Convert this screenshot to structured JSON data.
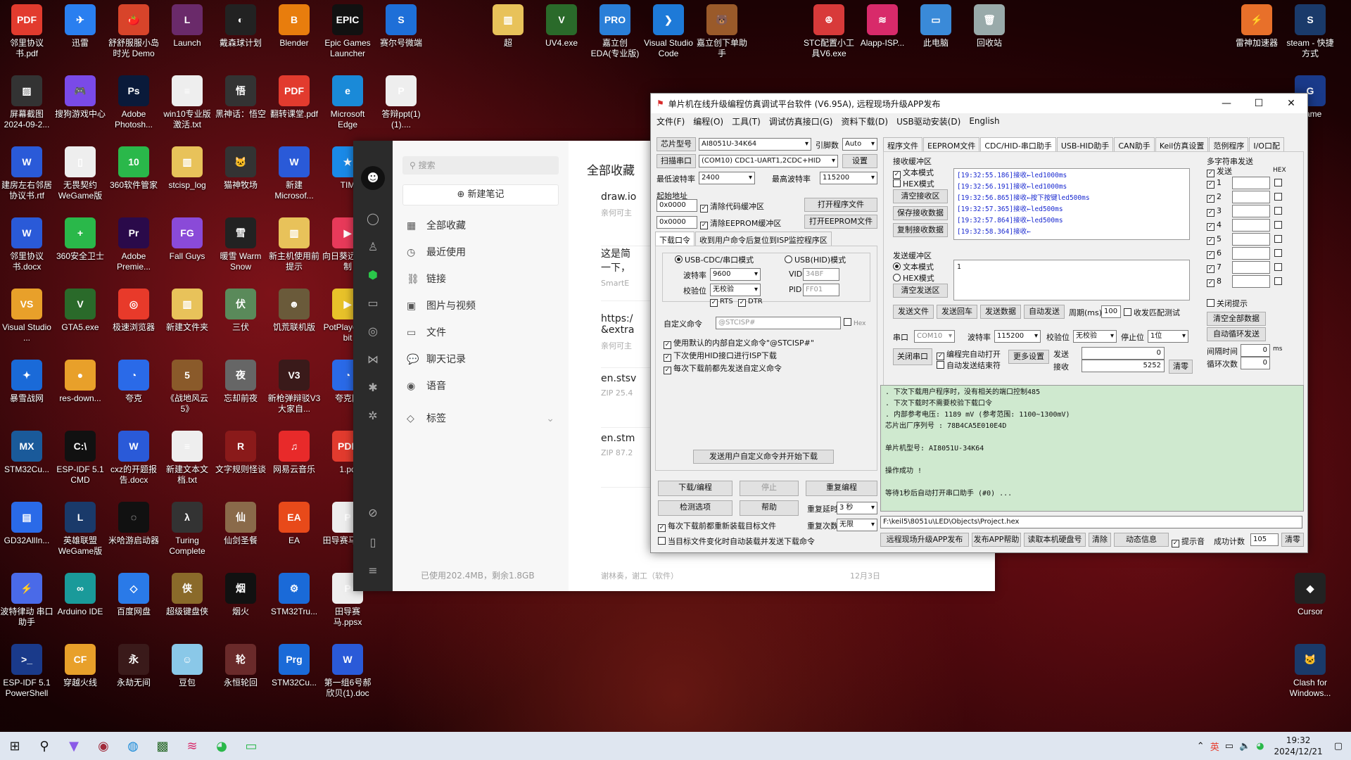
{
  "desktop": {
    "icons": [
      {
        "label": "邻里协议书.pdf",
        "col": 0,
        "row": 0,
        "color": "#e23b2e",
        "glyph": "PDF"
      },
      {
        "label": "迅雷",
        "col": 1,
        "row": 0,
        "color": "#2a7ff0",
        "glyph": "✈"
      },
      {
        "label": "舒舒服服小岛时光 Demo",
        "col": 2,
        "row": 0,
        "color": "#d8442a",
        "glyph": "🍅"
      },
      {
        "label": "Launch",
        "col": 3,
        "row": 0,
        "color": "#6a2a6a",
        "glyph": "L"
      },
      {
        "label": "戴森球计划",
        "col": 4,
        "row": 0,
        "color": "#222",
        "glyph": "◐"
      },
      {
        "label": "Blender",
        "col": 5,
        "row": 0,
        "color": "#e87d0d",
        "glyph": "B"
      },
      {
        "label": "Epic Games Launcher",
        "col": 6,
        "row": 0,
        "color": "#111",
        "glyph": "EPIC"
      },
      {
        "label": "赛尔号微端",
        "col": 7,
        "row": 0,
        "color": "#1e6fd8",
        "glyph": "S"
      },
      {
        "label": "超",
        "col": 9,
        "row": 0,
        "color": "#e8c25a",
        "glyph": "▥"
      },
      {
        "label": "UV4.exe",
        "col": 10,
        "row": 0,
        "color": "#2a6a2a",
        "glyph": "V"
      },
      {
        "label": "嘉立创EDA(专业版)",
        "col": 11,
        "row": 0,
        "color": "#2a7fd8",
        "glyph": "PRO"
      },
      {
        "label": "Visual Studio Code",
        "col": 12,
        "row": 0,
        "color": "#1e7ad8",
        "glyph": "❯"
      },
      {
        "label": "嘉立创下单助手",
        "col": 13,
        "row": 0,
        "color": "#9a5a2a",
        "glyph": "🐻"
      },
      {
        "label": "STC配置小工具V6.exe",
        "col": 15,
        "row": 0,
        "color": "#d83a3a",
        "glyph": "ꔮ"
      },
      {
        "label": "Alapp-ISP...",
        "col": 16,
        "row": 0,
        "color": "#d82a6a",
        "glyph": "≋"
      },
      {
        "label": "此电脑",
        "col": 17,
        "row": 0,
        "color": "#3a8ad8",
        "glyph": "▭"
      },
      {
        "label": "回收站",
        "col": 18,
        "row": 0,
        "color": "#9aa",
        "glyph": "🗑"
      },
      {
        "label": "雷神加速器",
        "col": 23,
        "row": 0,
        "color": "#e8702a",
        "glyph": "⚡"
      },
      {
        "label": "steam - 快捷方式",
        "col": 24,
        "row": 0,
        "color": "#1a3a6a",
        "glyph": "S"
      },
      {
        "label": "屏幕截图 2024-09-2...",
        "col": 0,
        "row": 1,
        "color": "#333",
        "glyph": "▨"
      },
      {
        "label": "搜狗游戏中心",
        "col": 1,
        "row": 1,
        "color": "#7a4ae8",
        "glyph": "🎮"
      },
      {
        "label": "Adobe Photosh...",
        "col": 2,
        "row": 1,
        "color": "#0a1a3a",
        "glyph": "Ps"
      },
      {
        "label": "win10专业版激活.txt",
        "col": 3,
        "row": 1,
        "color": "#eee",
        "glyph": "≡"
      },
      {
        "label": "黑神话：悟空",
        "col": 4,
        "row": 1,
        "color": "#333",
        "glyph": "悟"
      },
      {
        "label": "翻转课堂.pdf",
        "col": 5,
        "row": 1,
        "color": "#e23b2e",
        "glyph": "PDF"
      },
      {
        "label": "Microsoft Edge",
        "col": 6,
        "row": 1,
        "color": "#1a8ad8",
        "glyph": "e"
      },
      {
        "label": "答辩ppt(1)(1)....",
        "col": 7,
        "row": 1,
        "color": "#eee",
        "glyph": "P"
      },
      {
        "label": "Game",
        "col": 24,
        "row": 1,
        "color": "#1a3a8a",
        "glyph": "G"
      },
      {
        "label": "建房左右邻居协议书.rtf",
        "col": 0,
        "row": 2,
        "color": "#2a5ad8",
        "glyph": "W"
      },
      {
        "label": "无畏契约 WeGame版",
        "col": 1,
        "row": 2,
        "color": "#eee",
        "glyph": "▯"
      },
      {
        "label": "360软件管家",
        "col": 2,
        "row": 2,
        "color": "#2ab84a",
        "glyph": "10"
      },
      {
        "label": "stcisp_log",
        "col": 3,
        "row": 2,
        "color": "#e8c25a",
        "glyph": "▥"
      },
      {
        "label": "猫神牧场",
        "col": 4,
        "row": 2,
        "color": "#333",
        "glyph": "🐱"
      },
      {
        "label": "新建 Microsof...",
        "col": 5,
        "row": 2,
        "color": "#2a5ad8",
        "glyph": "W"
      },
      {
        "label": "TIM",
        "col": 6,
        "row": 2,
        "color": "#1a8ae8",
        "glyph": "★"
      },
      {
        "label": "邻里协议书.docx",
        "col": 0,
        "row": 3,
        "color": "#2a5ad8",
        "glyph": "W"
      },
      {
        "label": "360安全卫士",
        "col": 1,
        "row": 3,
        "color": "#2ab84a",
        "glyph": "+"
      },
      {
        "label": "Adobe Premie...",
        "col": 2,
        "row": 3,
        "color": "#2a0a4a",
        "glyph": "Pr"
      },
      {
        "label": "Fall Guys",
        "col": 3,
        "row": 3,
        "color": "#8a4ad8",
        "glyph": "FG"
      },
      {
        "label": "暖雪 Warm Snow",
        "col": 4,
        "row": 3,
        "color": "#222",
        "glyph": "雪"
      },
      {
        "label": "新主机使用前提示",
        "col": 5,
        "row": 3,
        "color": "#e8c25a",
        "glyph": "▥"
      },
      {
        "label": "向日葵远程控制",
        "col": 6,
        "row": 3,
        "color": "#e83a5a",
        "glyph": "▶"
      },
      {
        "label": "Visual Studio ...",
        "col": 0,
        "row": 4,
        "color": "#e8a02a",
        "glyph": "VS"
      },
      {
        "label": "GTA5.exe",
        "col": 1,
        "row": 4,
        "color": "#2a6a2a",
        "glyph": "V"
      },
      {
        "label": "极速浏览器",
        "col": 2,
        "row": 4,
        "color": "#e83a2a",
        "glyph": "◎"
      },
      {
        "label": "新建文件夹",
        "col": 3,
        "row": 4,
        "color": "#e8c25a",
        "glyph": "▥"
      },
      {
        "label": "三伏",
        "col": 4,
        "row": 4,
        "color": "#5a8a5a",
        "glyph": "伏"
      },
      {
        "label": "饥荒联机版",
        "col": 5,
        "row": 4,
        "color": "#6a5a3a",
        "glyph": "☻"
      },
      {
        "label": "PotPlayer 64 bit",
        "col": 6,
        "row": 4,
        "color": "#e8c22a",
        "glyph": "▶"
      },
      {
        "label": "暴雪战网",
        "col": 0,
        "row": 5,
        "color": "#1a6ad8",
        "glyph": "✦"
      },
      {
        "label": "res-down...",
        "col": 1,
        "row": 5,
        "color": "#e8a02a",
        "glyph": "●"
      },
      {
        "label": "夸克",
        "col": 2,
        "row": 5,
        "color": "#2a6ae8",
        "glyph": "◔"
      },
      {
        "label": "《战地风云 5》",
        "col": 3,
        "row": 5,
        "color": "#8a5a2a",
        "glyph": "5"
      },
      {
        "label": "忘却前夜",
        "col": 4,
        "row": 5,
        "color": "#666",
        "glyph": "夜"
      },
      {
        "label": "新枪弹辩驳V3 大家自...",
        "col": 5,
        "row": 5,
        "color": "#3a1a1a",
        "glyph": "V3"
      },
      {
        "label": "夸克网",
        "col": 6,
        "row": 5,
        "color": "#2a6ae8",
        "glyph": "◔"
      },
      {
        "label": "STM32Cu...",
        "col": 0,
        "row": 6,
        "color": "#1a5a9a",
        "glyph": "MX"
      },
      {
        "label": "ESP-IDF 5.1 CMD",
        "col": 1,
        "row": 6,
        "color": "#111",
        "glyph": "C:\\"
      },
      {
        "label": "cxz的开题报告.docx",
        "col": 2,
        "row": 6,
        "color": "#2a5ad8",
        "glyph": "W"
      },
      {
        "label": "新建文本文档.txt",
        "col": 3,
        "row": 6,
        "color": "#eee",
        "glyph": "≡"
      },
      {
        "label": "文字规则怪谈",
        "col": 4,
        "row": 6,
        "color": "#8a1a1a",
        "glyph": "R"
      },
      {
        "label": "网易云音乐",
        "col": 5,
        "row": 6,
        "color": "#e82a2a",
        "glyph": "♫"
      },
      {
        "label": "1.pd",
        "col": 6,
        "row": 6,
        "color": "#e23b2e",
        "glyph": "PDF"
      },
      {
        "label": "GD32AllIn...",
        "col": 0,
        "row": 7,
        "color": "#2a6ae8",
        "glyph": "▤"
      },
      {
        "label": "英雄联盟 WeGame版",
        "col": 1,
        "row": 7,
        "color": "#1a3a6a",
        "glyph": "L"
      },
      {
        "label": "米哈游启动器",
        "col": 2,
        "row": 7,
        "color": "#111",
        "glyph": "◌"
      },
      {
        "label": "Turing Complete",
        "col": 3,
        "row": 7,
        "color": "#333",
        "glyph": "λ"
      },
      {
        "label": "仙剑圣餐",
        "col": 4,
        "row": 7,
        "color": "#8a6a4a",
        "glyph": "仙"
      },
      {
        "label": "EA",
        "col": 5,
        "row": 7,
        "color": "#e84a1a",
        "glyph": "EA"
      },
      {
        "label": "田导赛马pptx",
        "col": 6,
        "row": 7,
        "color": "#eee",
        "glyph": "P"
      },
      {
        "label": "波特律动 串口助手",
        "col": 0,
        "row": 8,
        "color": "#4a6ae8",
        "glyph": "⚡"
      },
      {
        "label": "Arduino IDE",
        "col": 1,
        "row": 8,
        "color": "#1a9a9a",
        "glyph": "∞"
      },
      {
        "label": "百度网盘",
        "col": 2,
        "row": 8,
        "color": "#2a7ae8",
        "glyph": "◇"
      },
      {
        "label": "超级键盘侠",
        "col": 3,
        "row": 8,
        "color": "#8a6a2a",
        "glyph": "侠"
      },
      {
        "label": "烟火",
        "col": 4,
        "row": 8,
        "color": "#111",
        "glyph": "烟"
      },
      {
        "label": "STM32Tru...",
        "col": 5,
        "row": 8,
        "color": "#1a6ad8",
        "glyph": "⚙"
      },
      {
        "label": "田导赛马.ppsx",
        "col": 6,
        "row": 8,
        "color": "#eee",
        "glyph": "P"
      },
      {
        "label": "Cursor",
        "col": 24,
        "row": 8,
        "color": "#222",
        "glyph": "◆"
      },
      {
        "label": "ESP-IDF 5.1 PowerShell",
        "col": 0,
        "row": 9,
        "color": "#1a3a8a",
        "glyph": ">_"
      },
      {
        "label": "穿越火线",
        "col": 1,
        "row": 9,
        "color": "#e8a02a",
        "glyph": "CF"
      },
      {
        "label": "永劫无间",
        "col": 2,
        "row": 9,
        "color": "#3a1a1a",
        "glyph": "永"
      },
      {
        "label": "豆包",
        "col": 3,
        "row": 9,
        "color": "#8ac8e8",
        "glyph": "☺"
      },
      {
        "label": "永恒轮回",
        "col": 4,
        "row": 9,
        "color": "#6a2a2a",
        "glyph": "轮"
      },
      {
        "label": "STM32Cu...",
        "col": 5,
        "row": 9,
        "color": "#1a6ad8",
        "glyph": "Prg"
      },
      {
        "label": "第一组6号郝欣贝(1).doc",
        "col": 6,
        "row": 9,
        "color": "#2a5ad8",
        "glyph": "W"
      },
      {
        "label": "Clash for Windows...",
        "col": 24,
        "row": 9,
        "color": "#1a3a6a",
        "glyph": "🐱"
      }
    ]
  },
  "notes": {
    "search_placeholder": "搜索",
    "new_note": "新建笔记",
    "nav": [
      {
        "label": "全部收藏",
        "icon": "▦"
      },
      {
        "label": "最近使用",
        "icon": "◷"
      },
      {
        "label": "链接",
        "icon": "⛓"
      },
      {
        "label": "图片与视频",
        "icon": "▣"
      },
      {
        "label": "文件",
        "icon": "▭"
      },
      {
        "label": "聊天记录",
        "icon": "💬"
      },
      {
        "label": "语音",
        "icon": "◉"
      }
    ],
    "tags_label": "标签",
    "quota": "已使用202.4MB，剩余1.8GB",
    "header": "全部收藏",
    "items": [
      {
        "title": "draw.io",
        "sub": "亲何可主"
      },
      {
        "title": "这是简",
        "title2": "一下，",
        "sub": "SmartE"
      },
      {
        "title": "https:/",
        "title2": "&extra",
        "sub": "亲何可主"
      },
      {
        "title": "en.stsv",
        "sub": "ZIP 25.4"
      },
      {
        "title": "en.stm",
        "sub": "ZIP 87.2"
      }
    ],
    "footer_left": "谢林奏，谢工（软件）",
    "footer_right": "12月3日"
  },
  "stc": {
    "title": "单片机在线升级编程仿真调试平台软件 (V6.95A), 远程现场升级APP发布",
    "menu": [
      "文件(F)",
      "编程(O)",
      "工具(T)",
      "调试仿真接口(G)",
      "资料下载(D)",
      "USB驱动安装(D)",
      "English"
    ],
    "chip_label": "芯片型号",
    "chip_value": "AI8051U-34K64",
    "pin_label": "引脚数",
    "pin_value": "Auto",
    "scan_btn": "扫描串口",
    "port_value": "(COM10) CDC1-UART1,2CDC+HID",
    "settings_btn": "设置",
    "min_baud_label": "最低波特率",
    "min_baud": "2400",
    "max_baud_label": "最高波特率",
    "max_baud": "115200",
    "start_addr_label": "起始地址",
    "addr1": "0x0000",
    "addr2": "0x0000",
    "clear_code": "清除代码缓冲区",
    "clear_eeprom": "清除EEPROM缓冲区",
    "open_prog": "打开程序文件",
    "open_eeprom": "打开EEPROM文件",
    "lower_tabs": [
      "下载口令",
      "收到用户命令后复位到ISP监控程序区"
    ],
    "usb_cdc": "USB-CDC/串口模式",
    "usb_hid": "USB(HID)模式",
    "baud_label": "波特率",
    "baud": "9600",
    "vid_label": "VID",
    "vid": "34BF",
    "parity_label": "校验位",
    "parity": "无校验",
    "pid_label": "PID",
    "pid": "FF01",
    "rts": "RTS",
    "dtr": "DTR",
    "custom_cmd_label": "自定义命令",
    "custom_cmd": "@STCISP#",
    "hex": "Hex",
    "opt1": "使用默认的内部自定义命令\"@STCISP#\"",
    "opt2": "下次使用HID接口进行ISP下载",
    "opt3": "每次下载前都先发送自定义命令",
    "send_custom": "发送用户自定义命令并开始下载",
    "download_btn": "下载/编程",
    "stop_btn": "停止",
    "reprog_btn": "重复编程",
    "detect_btn": "检测选项",
    "help_btn": "帮助",
    "delay_label": "重复延时",
    "delay": "3 秒",
    "reload_opt": "每次下载前都重新装载目标文件",
    "repeat_label": "重复次数",
    "repeat": "无限",
    "auto_load_opt": "当目标文件变化时自动装载并发送下载命令",
    "right_tabs": [
      "程序文件",
      "EEPROM文件",
      "CDC/HID-串口助手",
      "USB-HID助手",
      "CAN助手",
      "Keil仿真设置",
      "范例程序",
      "I/O口配"
    ],
    "recv_label": "接收缓冲区",
    "text_mode": "文本模式",
    "hex_mode": "HEX模式",
    "clear_recv": "清空接收区",
    "save_recv": "保存接收数据",
    "copy_recv": "复制接收数据",
    "recv_log": [
      "[19:32:55.186]接收←led1000ms",
      "[19:32:56.191]接收←led1000ms",
      "[19:32:56.865]接收←按下按键led500ms",
      "[19:32:57.365]接收←led500ms",
      "[19:32:57.864]接收←led500ms",
      "[19:32:58.364]接收←"
    ],
    "send_label": "发送缓冲区",
    "clear_send": "清空发送区",
    "send_value": "1",
    "send_file": "发送文件",
    "send_cr": "发送回车",
    "send_data": "发送数据",
    "auto_send": "自动发送",
    "period_label": "周期(ms)",
    "period": "100",
    "recv_match": "收发匹配测试",
    "port_label": "串口",
    "port": "COM10",
    "baud2_label": "波特率",
    "baud2": "115200",
    "parity2_label": "校验位",
    "parity2": "无校验",
    "stop_label": "停止位",
    "stop": "1位",
    "close_port": "关闭串口",
    "auto_open": "编程完自动打开",
    "auto_close": "自动发送结束符",
    "more_settings": "更多设置",
    "sent_label": "发送",
    "sent": "0",
    "recv_cnt_label": "接收",
    "recv_cnt": "5252",
    "clear_cnt": "清零",
    "multi_label": "多字符串发送",
    "send_col": "发送",
    "hex_col": "HEX",
    "multi_rows": [
      "1",
      "2",
      "3",
      "4",
      "5",
      "6",
      "7",
      "8"
    ],
    "close_tip": "关闭提示",
    "clear_all": "清空全部数据",
    "auto_loop": "自动循环发送",
    "interval_label": "间隔时间",
    "interval": "0",
    "interval_unit": "ms",
    "loop_label": "循环次数",
    "loop": "0",
    "info_lines": [
      ". 下次下载用户程序时，没有相关的端口控制485",
      ". 下次下载时不需要校验下载口令",
      ". 内部参考电压: 1189 mV (参考范围: 1100~1300mV)",
      "芯片出厂序列号 : 78B4CA5E010E4D",
      "",
      "  单片机型号: AI8051U-34K64",
      "",
      "操作成功 !",
      "",
      "等待1秒后自动打开串口助手 (#0) ..."
    ],
    "file_path": "F:\\keil5\\8051u\\LED\\Objects\\Project.hex",
    "bottom_btns": [
      "远程现场升级APP发布",
      "发布APP帮助",
      "读取本机硬盘号",
      "清除",
      "动态信息"
    ],
    "beep": "提示音",
    "success_label": "成功计数",
    "success": "105",
    "clear2": "清零"
  },
  "taskbar": {
    "ime": "英",
    "time": "19:32",
    "date": "2024/12/21"
  }
}
